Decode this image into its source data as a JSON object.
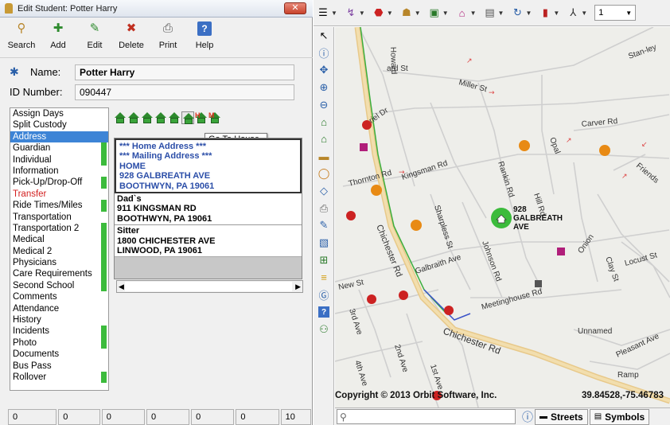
{
  "window": {
    "title": "Edit Student: Potter Harry",
    "close_label": "✕"
  },
  "toolbar": {
    "buttons": [
      {
        "label": "Search",
        "icon": "search-icon"
      },
      {
        "label": "Add",
        "icon": "add-icon"
      },
      {
        "label": "Edit",
        "icon": "edit-icon"
      },
      {
        "label": "Delete",
        "icon": "delete-icon"
      },
      {
        "label": "Print",
        "icon": "print-icon"
      },
      {
        "label": "Help",
        "icon": "help-icon"
      }
    ]
  },
  "student": {
    "name_label": "Name:",
    "name": "Potter Harry",
    "id_label": "ID Number:",
    "id": "090447"
  },
  "menu": {
    "items": [
      {
        "label": "Assign Days",
        "mark": false,
        "selected": false,
        "red": false
      },
      {
        "label": "Split Custody",
        "mark": false,
        "selected": false,
        "red": false
      },
      {
        "label": "Address",
        "mark": false,
        "selected": true,
        "red": false
      },
      {
        "label": "Guardian",
        "mark": true,
        "selected": false,
        "red": false
      },
      {
        "label": "Individual",
        "mark": true,
        "selected": false,
        "red": false
      },
      {
        "label": "Information",
        "mark": false,
        "selected": false,
        "red": false
      },
      {
        "label": "Pick-Up/Drop-Off",
        "mark": true,
        "selected": false,
        "red": false
      },
      {
        "label": "Transfer",
        "mark": false,
        "selected": false,
        "red": true
      },
      {
        "label": "Ride Times/Miles",
        "mark": true,
        "selected": false,
        "red": false
      },
      {
        "label": "Transportation",
        "mark": false,
        "selected": false,
        "red": false
      },
      {
        "label": "Transportation 2",
        "mark": true,
        "selected": false,
        "red": false
      },
      {
        "label": "Medical",
        "mark": true,
        "selected": false,
        "red": false
      },
      {
        "label": "Medical 2",
        "mark": true,
        "selected": false,
        "red": false
      },
      {
        "label": "Physicians",
        "mark": true,
        "selected": false,
        "red": false
      },
      {
        "label": "Care Requirements",
        "mark": true,
        "selected": false,
        "red": false
      },
      {
        "label": "Second School",
        "mark": true,
        "selected": false,
        "red": false
      },
      {
        "label": "Comments",
        "mark": false,
        "selected": false,
        "red": false
      },
      {
        "label": "Attendance",
        "mark": false,
        "selected": false,
        "red": false
      },
      {
        "label": "History",
        "mark": false,
        "selected": false,
        "red": false
      },
      {
        "label": "Incidents",
        "mark": true,
        "selected": false,
        "red": false
      },
      {
        "label": "Photo",
        "mark": true,
        "selected": false,
        "red": false
      },
      {
        "label": "Documents",
        "mark": false,
        "selected": false,
        "red": false
      },
      {
        "label": "Bus Pass",
        "mark": false,
        "selected": false,
        "red": false
      },
      {
        "label": "Rollover",
        "mark": true,
        "selected": false,
        "red": false
      }
    ]
  },
  "address_tools": {
    "tooltip": "Go To House",
    "marks": [
      "",
      "",
      "",
      "",
      "",
      "",
      "H",
      "M"
    ]
  },
  "addresses": {
    "first": {
      "line1": "*** Home Address ***",
      "line2": "*** Mailing Address ***",
      "line3": "HOME",
      "line4": "928 GALBREATH AVE",
      "line5": "BOOTHWYN, PA 19061"
    },
    "second": {
      "line1": "Dad`s",
      "line2": "911 KINGSMAN RD",
      "line3": "BOOTHWYN, PA 19061"
    },
    "third": {
      "line1": "Sitter",
      "line2": "1800 CHICHESTER AVE",
      "line3": "LINWOOD, PA 19061"
    }
  },
  "statusbar": {
    "cells": [
      "0",
      "0",
      "0",
      "0",
      "0",
      "0",
      "10"
    ]
  },
  "map_toolbar": {
    "zoom": "1"
  },
  "map": {
    "copyright": "Copyright © 2013 Orbit Software, Inc.",
    "coords": "39.84528,-75.46783",
    "house_label_num": "928",
    "house_label_street": "GALBREATH",
    "house_label_suffix": "AVE",
    "roads": {
      "howard": "Howard St",
      "stanley": "Stan-ley",
      "miller": "Miller St",
      "carver": "Carver Rd",
      "opal": "Opal",
      "thornton": "Thornton Rd",
      "kingsman": "Kingsman Rd",
      "rankin": "Rankin Rd",
      "friends": "Friends",
      "hill": "Hill Rd",
      "shapless": "Sharpless St",
      "chichester_v": "Chichester Rd",
      "galbraith": "Galbraith Ave",
      "johnson": "Johnson Rd",
      "onion": "Onion",
      "locust": "Locust St",
      "clay": "Clay St",
      "new": "New St",
      "meetinghouse": "Meetinghouse Rd",
      "third": "3rd Ave",
      "chichester_h": "Chichester Rd",
      "unnamed": "Unnamed",
      "pleasant": "Pleasant Ave",
      "second": "2nd Ave",
      "first": "1st Ave",
      "fourth": "4th Ave",
      "ramp": "Ramp",
      "ariel": "Ariel Dr"
    }
  },
  "map_bottom": {
    "streets": "Streets",
    "symbols": "Symbols"
  }
}
